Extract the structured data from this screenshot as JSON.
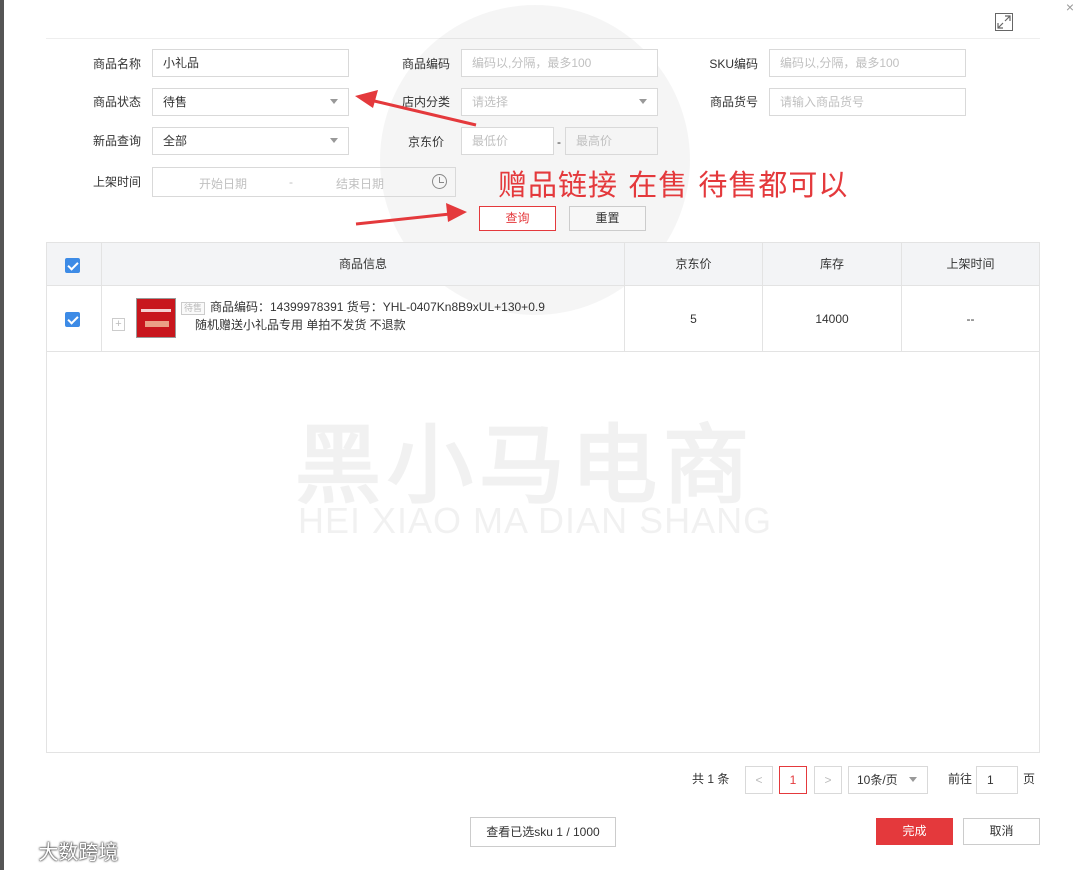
{
  "form": {
    "name_label": "商品名称",
    "name_value": "小礼品",
    "code_label": "商品编码",
    "code_placeholder": "编码以,分隔，最多100",
    "sku_label": "SKU编码",
    "sku_placeholder": "编码以,分隔，最多100",
    "status_label": "商品状态",
    "status_value": "待售",
    "category_label": "店内分类",
    "category_placeholder": "请选择",
    "item_no_label": "商品货号",
    "item_no_placeholder": "请输入商品货号",
    "new_label": "新品查询",
    "new_value": "全部",
    "price_label": "京东价",
    "price_min_placeholder": "最低价",
    "price_sep": "-",
    "price_max_placeholder": "最高价",
    "date_label": "上架时间",
    "date_start_placeholder": "开始日期",
    "date_sep": "-",
    "date_end_placeholder": "结束日期",
    "query_label": "查询",
    "reset_label": "重置"
  },
  "annotation": {
    "text": "赠品链接 在售  待售都可以",
    "color": "#e4393c"
  },
  "table": {
    "headers": [
      "商品信息",
      "京东价",
      "库存",
      "上架时间"
    ],
    "header_all_checked": true,
    "rows": [
      {
        "checked": true,
        "status_tag": "待售",
        "code_line": "商品编码：14399978391  货号：YHL-0407Kn8B9xUL+130+0.9",
        "name_line": "随机赠送小礼品专用 单拍不发货 不退款",
        "price": "5",
        "stock": "14000",
        "shelf_time": "--"
      }
    ]
  },
  "watermark": {
    "big": "黑小马电商",
    "small": "HEI XIAO MA DIAN SHANG"
  },
  "pagination": {
    "total": "共 1 条",
    "prev": "<",
    "current_page": "1",
    "next": ">",
    "page_size": "10条/页",
    "goto_label": "前往",
    "goto_value": "1",
    "page_unit": "页"
  },
  "footer": {
    "view_selected": "查看已选sku 1 / 1000",
    "done": "完成",
    "cancel": "取消"
  },
  "brand": {
    "text": "大数跨境"
  },
  "colors": {
    "accent": "#e4393c",
    "checkbox": "#3d8be6"
  }
}
